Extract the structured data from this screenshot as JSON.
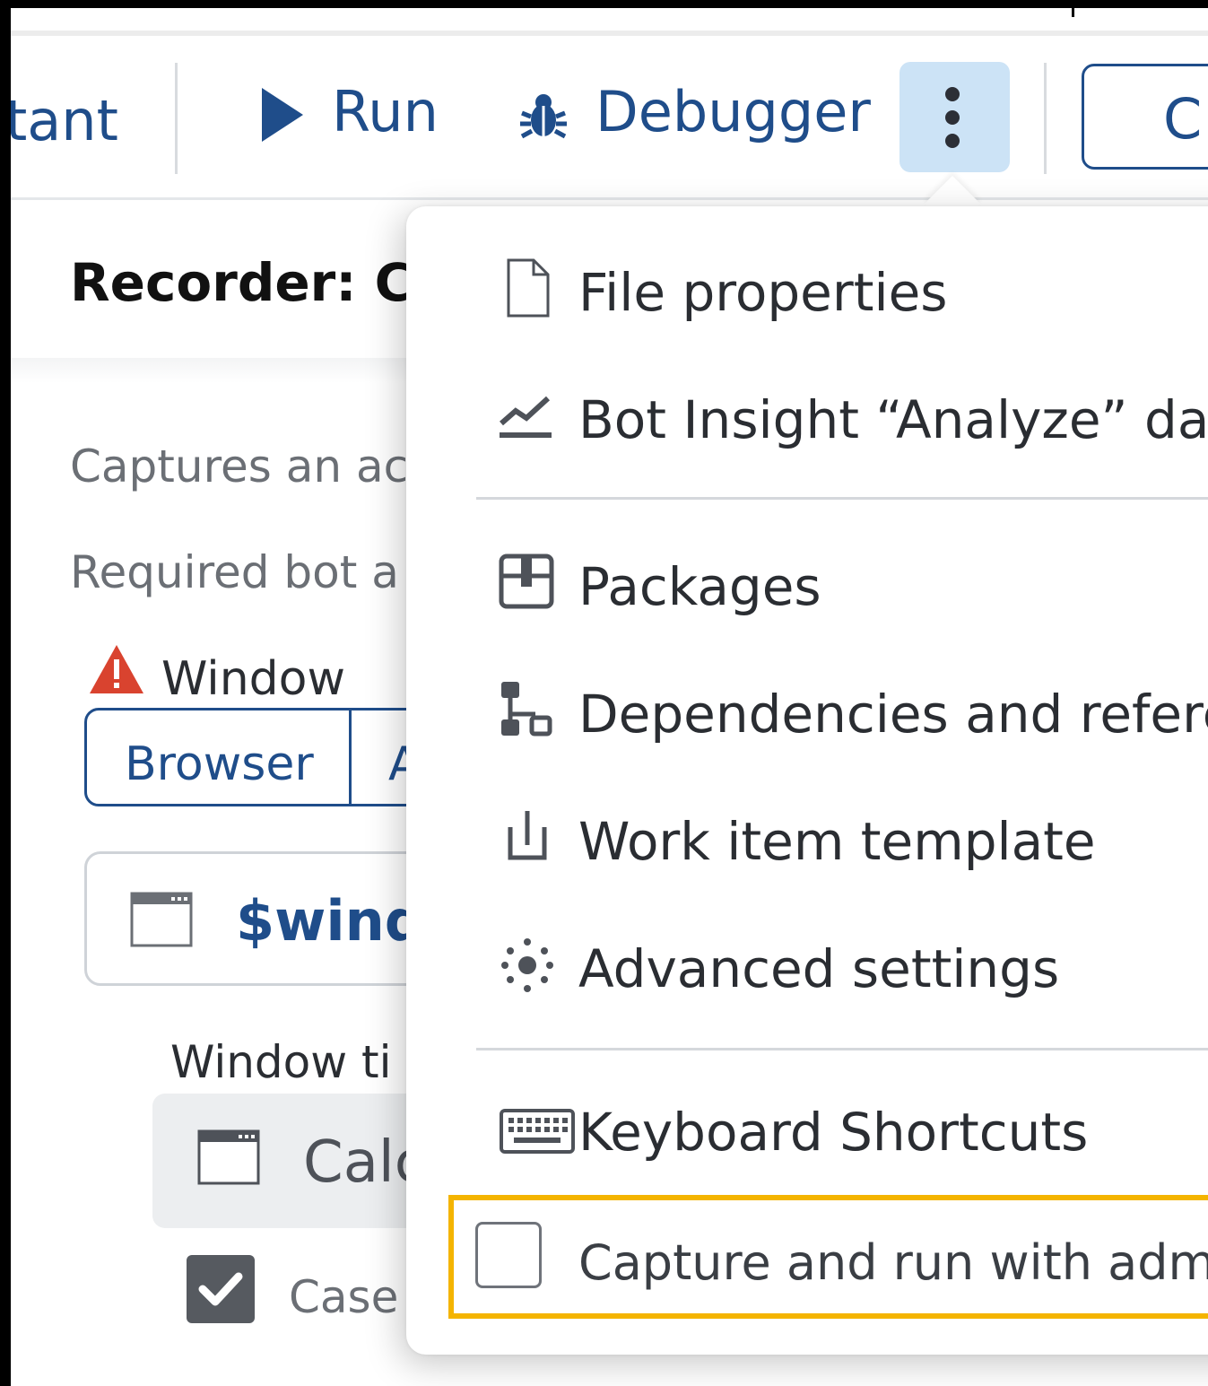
{
  "toolbar": {
    "partial_left_label": "tant",
    "run_label": "Run",
    "debugger_label": "Debugger",
    "more_button": "more-vertical-icon",
    "partial_right_button_label": "C"
  },
  "page": {
    "title": "Recorder: Ca",
    "description": "Captures an ac",
    "required": "Required bot a",
    "window_label": "Window",
    "window_tabs": [
      "Browser",
      "A"
    ],
    "window_variable": "$wind",
    "window_title_label": "Window ti",
    "window_title_value": "Calc",
    "case_label": "Case"
  },
  "menu": {
    "items": [
      {
        "label": "File properties",
        "icon": "file-icon"
      },
      {
        "label": "Bot Insight “Analyze” dash",
        "icon": "chart-icon"
      },
      {
        "label": "Packages",
        "icon": "package-icon"
      },
      {
        "label": "Dependencies and refere",
        "icon": "dependencies-icon"
      },
      {
        "label": "Work item template",
        "icon": "work-item-icon"
      },
      {
        "label": "Advanced settings",
        "icon": "settings-dots-icon"
      },
      {
        "label": "Keyboard Shortcuts",
        "icon": "keyboard-icon"
      }
    ],
    "admin_option": {
      "label": "Capture and run with admi",
      "checked": false
    }
  },
  "colors": {
    "accent": "#1f4d8a",
    "highlight": "#f4b400",
    "more_button_bg": "#cce3f6",
    "warning": "#d9432f"
  }
}
